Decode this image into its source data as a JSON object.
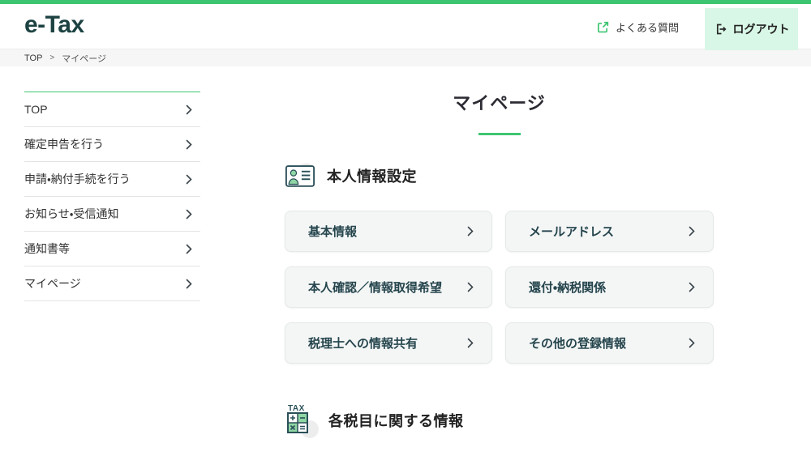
{
  "header": {
    "logo": "e-Tax",
    "faq_label": "よくある質問",
    "logout_label": "ログアウト"
  },
  "breadcrumb": {
    "home": "TOP",
    "separator": ">",
    "current": "マイページ"
  },
  "sidebar": {
    "items": [
      {
        "label": "TOP"
      },
      {
        "label": "確定申告を行う"
      },
      {
        "label": "申請・納付手続を行う"
      },
      {
        "label": "お知らせ・受信通知"
      },
      {
        "label": "通知書等"
      },
      {
        "label": "マイページ"
      }
    ]
  },
  "main": {
    "title": "マイページ",
    "sections": [
      {
        "heading": "本人情報設定",
        "icon": "id-card-icon",
        "buttons": [
          "基本情報",
          "メールアドレス",
          "本人確認／情報取得希望",
          "還付・納税関係",
          "税理士への情報共有",
          "その他の登録情報"
        ]
      },
      {
        "heading": "各税目に関する情報",
        "icon": "tax-calculator-icon",
        "tax_label": "TAX"
      }
    ]
  },
  "colors": {
    "accent_green": "#3dc571",
    "mint": "#d9f7e6",
    "logo_teal": "#1d4242",
    "icon_teal": "#2a5058",
    "icon_green": "#8fd6a4",
    "button_text": "#25454d"
  }
}
